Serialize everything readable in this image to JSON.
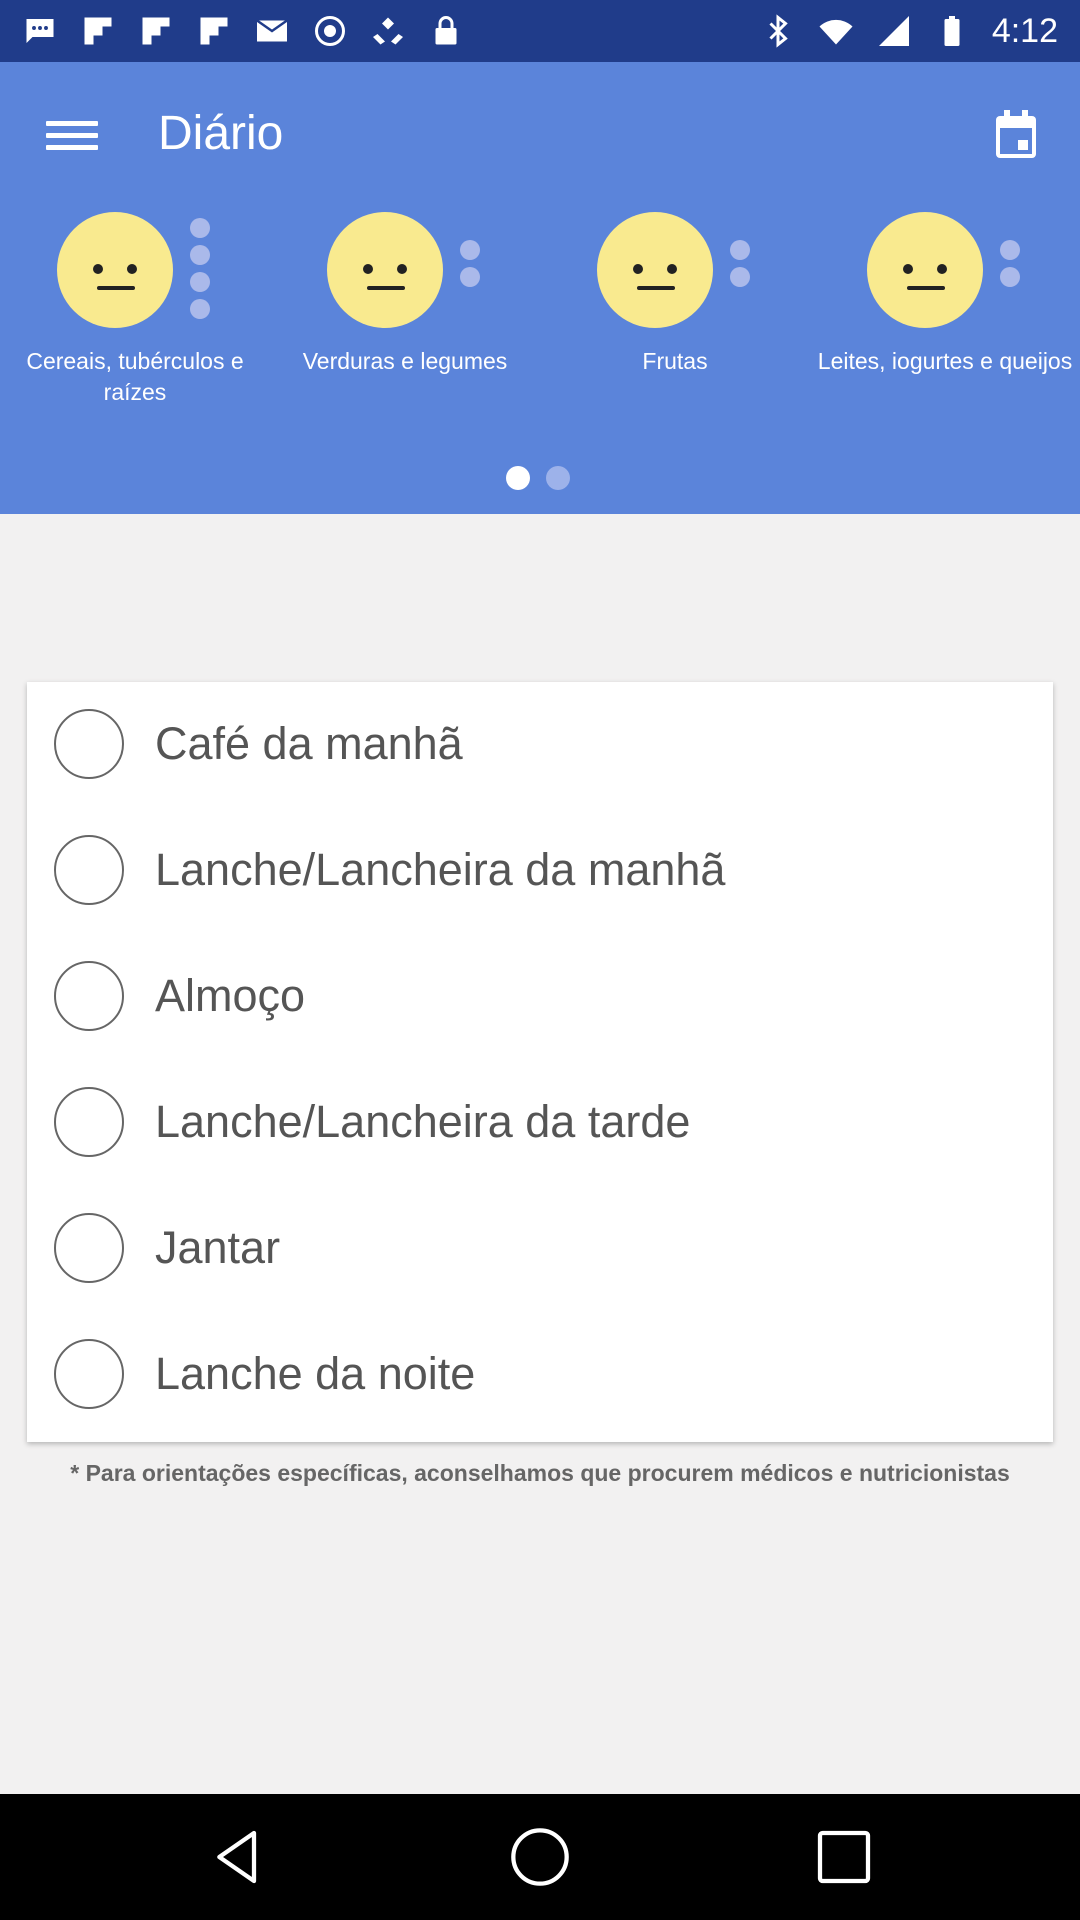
{
  "status_bar": {
    "time": "4:12",
    "icons": [
      "messages-icon",
      "flipboard-icon",
      "flipboard-icon",
      "flipboard-icon",
      "email-icon",
      "do-not-disturb-icon",
      "fake-gps-icon",
      "lock-icon",
      "bluetooth-icon",
      "wifi-icon",
      "signal-icon",
      "battery-icon"
    ]
  },
  "app_bar": {
    "title": "Diário",
    "menu_icon": "hamburger-menu-icon",
    "calendar_icon": "calendar-icon"
  },
  "food_groups": [
    {
      "label": "Cereais, tubérculos e raízes",
      "mood": "neutral"
    },
    {
      "label": "Verduras e legumes",
      "mood": "neutral"
    },
    {
      "label": "Frutas",
      "mood": "neutral"
    },
    {
      "label": "Leites, iogurtes e queijos",
      "mood": "neutral"
    }
  ],
  "pager": {
    "pages": 2,
    "current": 1
  },
  "meals": [
    {
      "label": "Café da manhã",
      "checked": false
    },
    {
      "label": "Lanche/Lancheira da manhã",
      "checked": false
    },
    {
      "label": "Almoço",
      "checked": false
    },
    {
      "label": "Lanche/Lancheira da tarde",
      "checked": false
    },
    {
      "label": "Jantar",
      "checked": false
    },
    {
      "label": "Lanche da noite",
      "checked": false
    }
  ],
  "footnote": "* Para orientações específicas, aconselhamos que procurem médicos e nutricionistas",
  "nav_bar": {
    "icons": [
      "back-icon",
      "home-icon",
      "recents-icon"
    ]
  },
  "colors": {
    "status_bar": "#203c8a",
    "header": "#5b84da",
    "face": "#f9ea8f",
    "background": "#f2f1f1"
  }
}
